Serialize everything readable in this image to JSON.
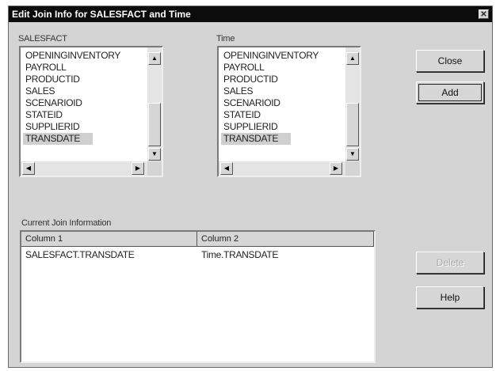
{
  "window": {
    "title": "Edit Join Info for SALESFACT and Time",
    "close_glyph": "✕"
  },
  "left_list": {
    "label": "SALESFACT",
    "items": [
      "OPENINGINVENTORY",
      "PAYROLL",
      "PRODUCTID",
      "SALES",
      "SCENARIOID",
      "STATEID",
      "SUPPLIERID",
      "TRANSDATE"
    ],
    "selected": "TRANSDATE"
  },
  "right_list": {
    "label": "Time",
    "items": [
      "OPENINGINVENTORY",
      "PAYROLL",
      "PRODUCTID",
      "SALES",
      "SCENARIOID",
      "STATEID",
      "SUPPLIERID",
      "TRANSDATE"
    ],
    "selected": "TRANSDATE"
  },
  "buttons": {
    "close": "Close",
    "add": "Add",
    "delete": "Delete",
    "help": "Help"
  },
  "join_info": {
    "label": "Current Join Information",
    "columns": [
      "Column 1",
      "Column 2"
    ],
    "rows": [
      {
        "col1": "SALESFACT.TRANSDATE",
        "col2": "Time.TRANSDATE"
      }
    ]
  },
  "scroll_glyphs": {
    "up": "▲",
    "down": "▼",
    "left": "◀",
    "right": "▶"
  }
}
